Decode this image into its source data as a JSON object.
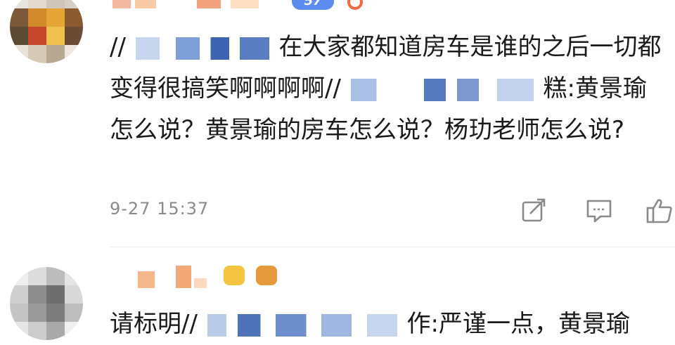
{
  "comment1": {
    "badge_text": "57",
    "body_parts": {
      "p1": "//",
      "p2": "在大家都知道房车是谁的之后一切都变得很搞笑啊啊啊啊//",
      "p3": "糕:黄景瑜怎么说？黄景瑜的房车怎么说？杨玏老师怎么说?"
    },
    "timestamp": "9-27 15:37"
  },
  "comment2": {
    "body_parts": {
      "p1": "请标明//",
      "p2": "作:严谨一点，黄景瑜"
    }
  },
  "icons": {
    "repost": "repost-icon",
    "reply": "reply-icon",
    "like": "thumbs-up-icon"
  },
  "colors": {
    "timestamp": "#8a8a8a",
    "text": "#1a1a1a",
    "action_icon": "#8a8a8a",
    "badge": "#5b8df0"
  }
}
